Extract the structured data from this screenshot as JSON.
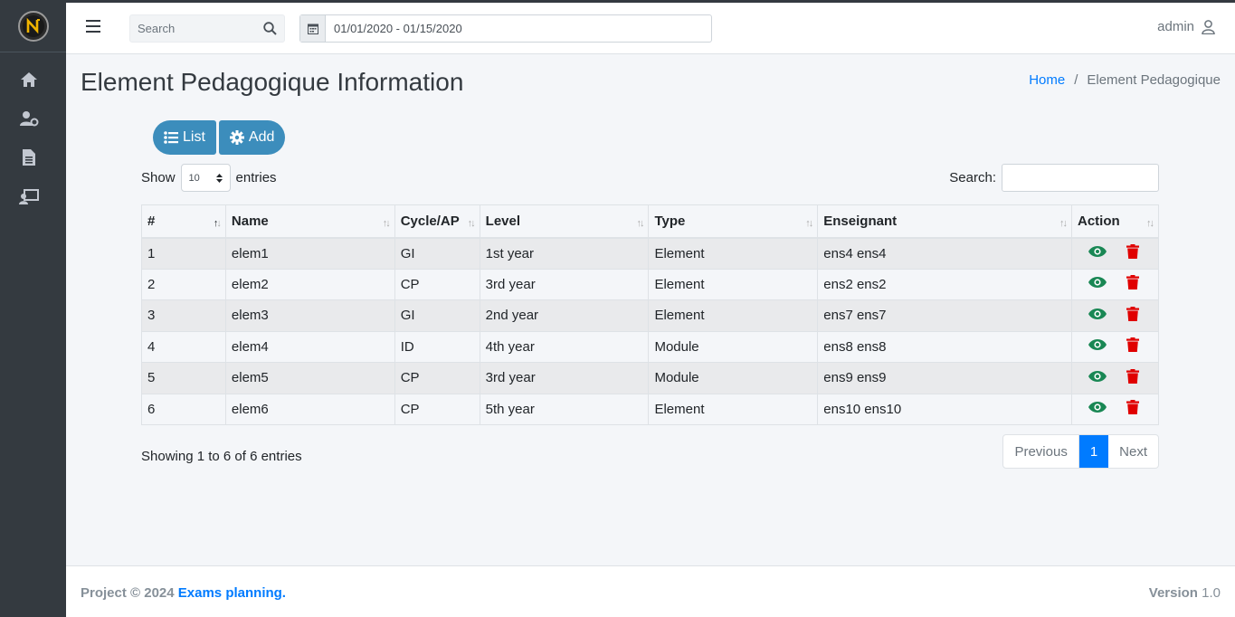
{
  "navbar": {
    "search_placeholder": "Search",
    "date_range": "01/01/2020 - 01/15/2020",
    "user": "admin"
  },
  "sidebar": {
    "items": [
      {
        "icon": "home-icon"
      },
      {
        "icon": "user-cog-icon"
      },
      {
        "icon": "file-icon"
      },
      {
        "icon": "chalkboard-teacher-icon"
      }
    ]
  },
  "page": {
    "title": "Element Pedagogique Information",
    "breadcrumb": {
      "home": "Home",
      "separator": "/",
      "current": "Element Pedagogique"
    }
  },
  "buttons": {
    "list": "List",
    "add": "Add"
  },
  "table_controls": {
    "show": "Show",
    "entries_value": "10",
    "entries": "entries",
    "search_label": "Search:"
  },
  "table": {
    "headers": [
      "#",
      "Name",
      "Cycle/AP",
      "Level",
      "Type",
      "Enseignant",
      "Action"
    ],
    "rows": [
      [
        "1",
        "elem1",
        "GI",
        "1st year",
        "Element",
        "ens4 ens4"
      ],
      [
        "2",
        "elem2",
        "CP",
        "3rd year",
        "Element",
        "ens2 ens2"
      ],
      [
        "3",
        "elem3",
        "GI",
        "2nd year",
        "Element",
        "ens7 ens7"
      ],
      [
        "4",
        "elem4",
        "ID",
        "4th year",
        "Module",
        "ens8 ens8"
      ],
      [
        "5",
        "elem5",
        "CP",
        "3rd year",
        "Module",
        "ens9 ens9"
      ],
      [
        "6",
        "elem6",
        "CP",
        "5th year",
        "Element",
        "ens10 ens10"
      ]
    ]
  },
  "pagination": {
    "info": "Showing 1 to 6 of 6 entries",
    "previous": "Previous",
    "current": "1",
    "next": "Next"
  },
  "footer": {
    "prefix": "Project © 2024",
    "link": "Exams planning.",
    "version_label": "Version",
    "version": "1.0"
  },
  "colors": {
    "sidebar": "#343a40",
    "primary_button": "#3c8dbc",
    "view_icon": "#198754",
    "delete_icon": "#e00000",
    "link": "#007bff"
  }
}
